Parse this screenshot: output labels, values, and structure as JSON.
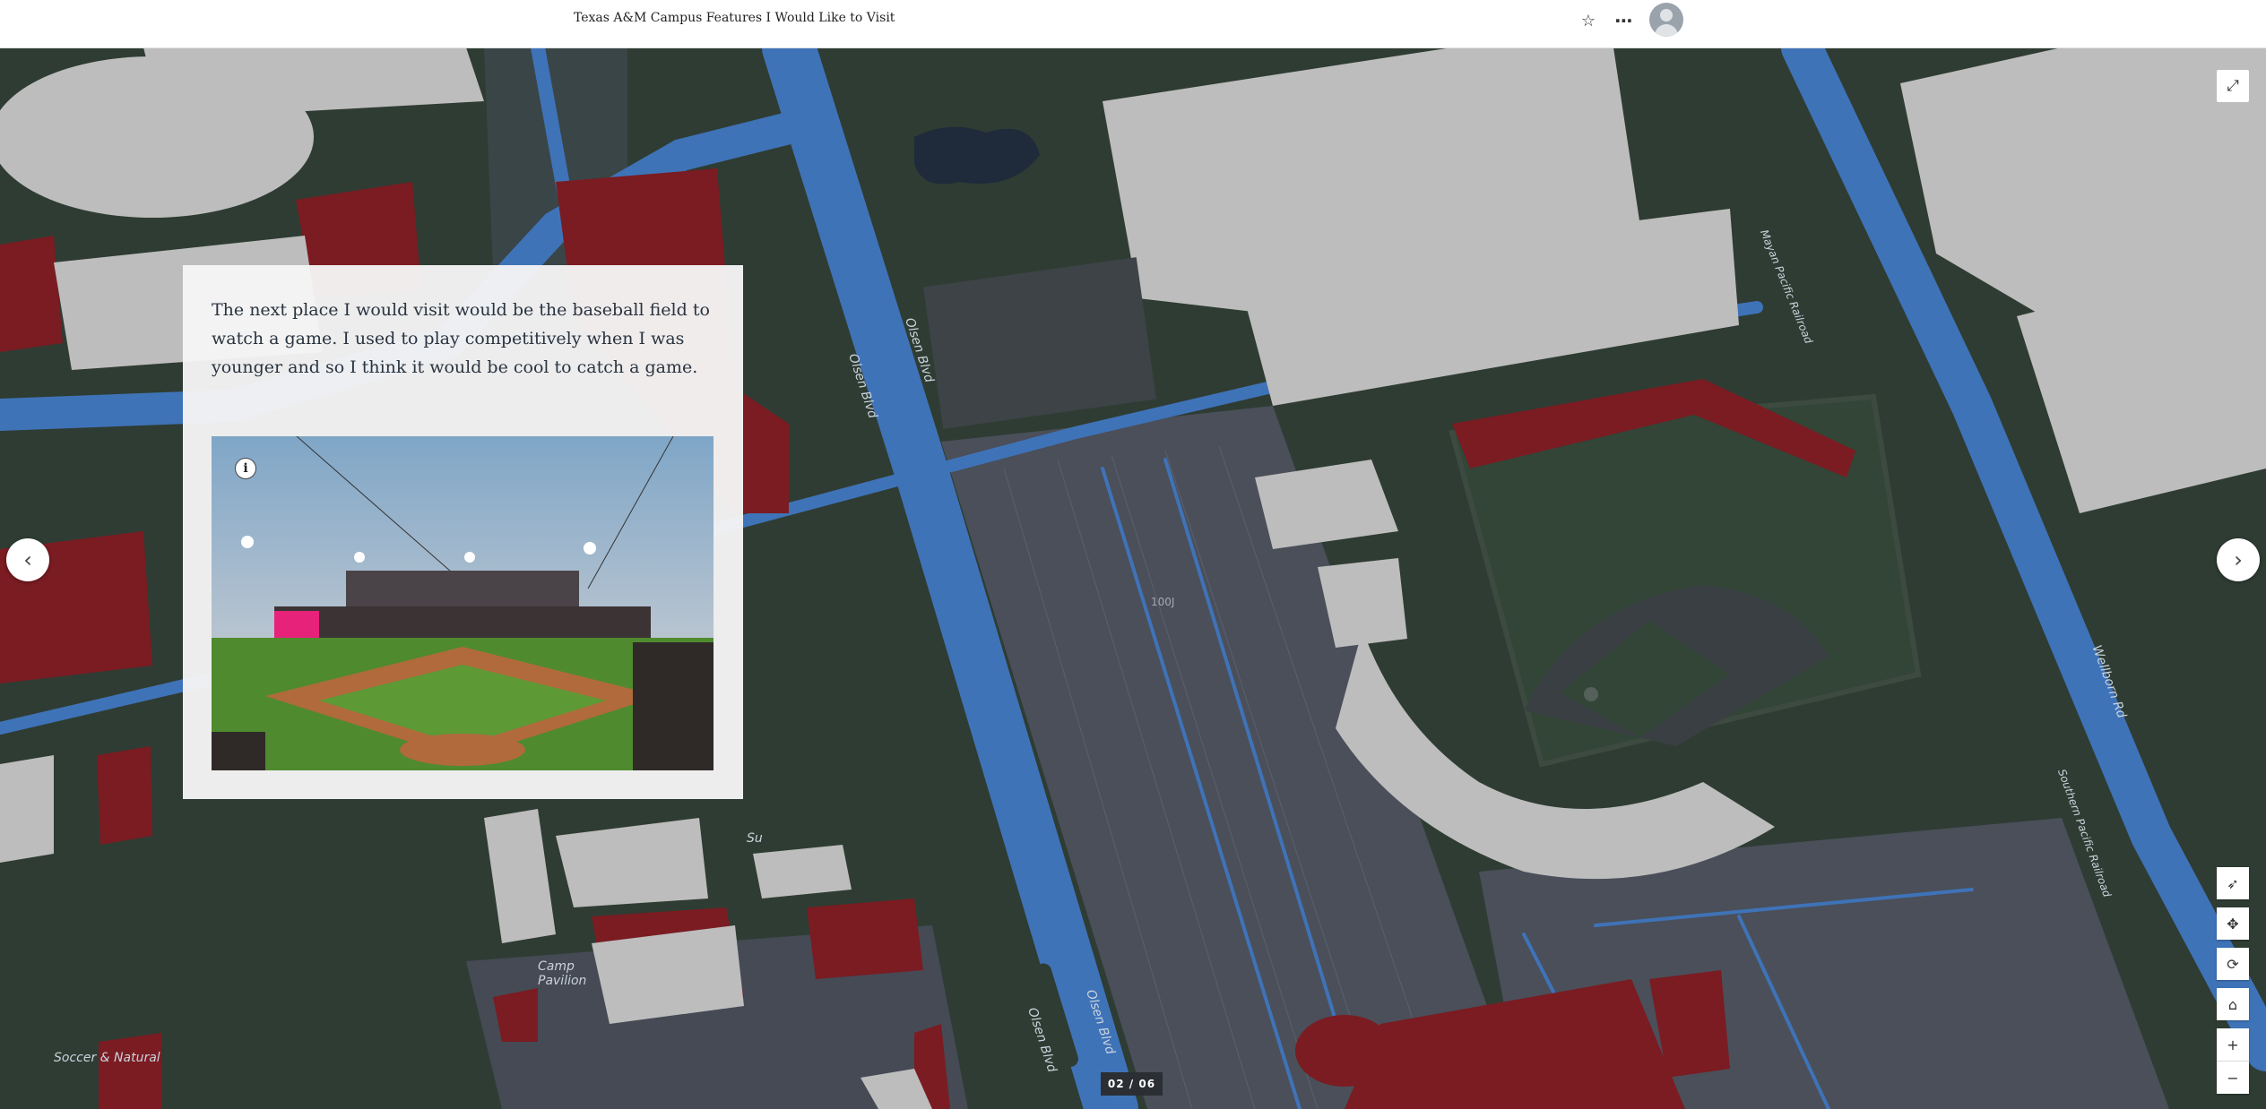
{
  "header": {
    "title": "Texas A&M Campus Features I Would Like to Visit",
    "favorite_icon": "star-icon",
    "more_icon": "more-icon",
    "avatar_icon": "user-avatar-icon"
  },
  "panel": {
    "text": "The next place I would visit would be the baseball field to watch a game. I used to play competitively when I was younger and so I think it would be cool to catch a game.",
    "info_label": "i"
  },
  "navigation": {
    "prev_icon": "chevron-left-icon",
    "next_icon": "chevron-right-icon",
    "counter": "02 / 06"
  },
  "map_labels": {
    "olsen_blvd_1": "Olsen Blvd",
    "olsen_blvd_2": "Olsen Blvd",
    "olsen_blvd_3": "Olsen Blvd",
    "olsen_blvd_4": "Olsen Blvd",
    "lot": "100J",
    "wellborn": "Wellborn Rd",
    "railroad_1": "Mayan Pacific Railroad",
    "railroad_2": "Southern Pacific Railroad",
    "camp_pavilion": "Camp Pavilion",
    "soccer": "Soccer & Natural",
    "sub": "Su"
  },
  "map_tools": [
    "compass-icon",
    "pan-icon",
    "rotate-icon",
    "home-icon",
    "zoom-in-icon",
    "zoom-out-icon"
  ],
  "colors": {
    "road": "#3f73b8",
    "maroon": "#7a1c22",
    "building": "#bdbdbd",
    "grass": "#2f3c33"
  }
}
